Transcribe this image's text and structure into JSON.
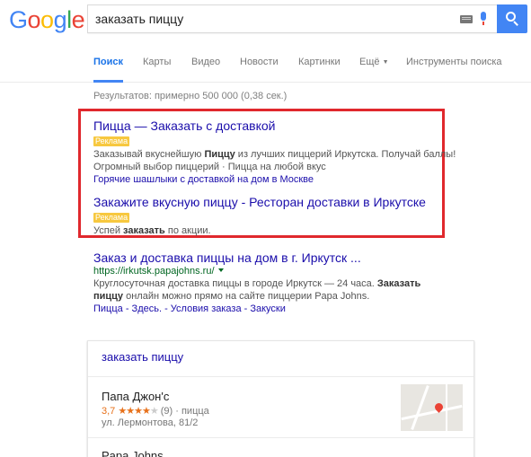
{
  "header": {
    "logo_letters": [
      {
        "ch": "G",
        "color": "#4285f4"
      },
      {
        "ch": "o",
        "color": "#ea4335"
      },
      {
        "ch": "o",
        "color": "#fbbc05"
      },
      {
        "ch": "g",
        "color": "#4285f4"
      },
      {
        "ch": "l",
        "color": "#34a853"
      },
      {
        "ch": "e",
        "color": "#ea4335"
      }
    ],
    "query": "заказать пиццу",
    "icons": [
      "keyboard-icon",
      "mic-icon",
      "search-icon"
    ]
  },
  "tabs": [
    "Поиск",
    "Карты",
    "Видео",
    "Новости",
    "Картинки",
    "Ещё",
    "Инструменты поиска"
  ],
  "stats": "Результатов: примерно 500 000 (0,38 сек.)",
  "ads": [
    {
      "title": "Пицца — Заказать с доставкой",
      "badge": "Реклама",
      "line1_pre": "Заказывай вкуснейшую ",
      "line1_bold": "Пиццу",
      "line1_post": " из лучших пиццерий Иркутска. Получай баллы!",
      "line2": "Огромный выбор пиццерий · Пицца на любой вкус",
      "extension": "Горячие шашлыки с доставкой на дом в Москве"
    },
    {
      "title": "Закажите вкусную пиццу - Ресторан доставки в Иркутске",
      "badge": "Реклама",
      "line1_pre": "Успей ",
      "line1_bold": "заказать",
      "line1_post": " по акции."
    }
  ],
  "organic": {
    "title": "Заказ и доставка пиццы на дом в г. Иркутск ...",
    "url": "https://irkutsk.papajohns.ru/",
    "snip1_pre": "Круглосуточная доставка пиццы в городе Иркутск — 24 часа. ",
    "snip1_bold": "Заказать",
    "snip2_bold": "пиццу",
    "snip2_post": " онлайн можно прямо на сайте пиццерии Papa Johns.",
    "sitelinks": "Пицца - Здесь. - Условия заказа - Закуски"
  },
  "local": {
    "query": "заказать пиццу",
    "place1": {
      "name": "Папа Джон'с",
      "rating": "3,7",
      "stars": "★★★★",
      "star_half": "★",
      "reviews": "(9) · пицца",
      "address": "ул. Лермонтова, 81/2"
    },
    "place2_name": "Papa Johns"
  },
  "colors": {
    "accent": "#4285f4",
    "link": "#1a0dab",
    "url_green": "#006621",
    "ad_badge": "#f7c83f",
    "highlight_box": "#e0282d",
    "rating": "#e7711b"
  }
}
